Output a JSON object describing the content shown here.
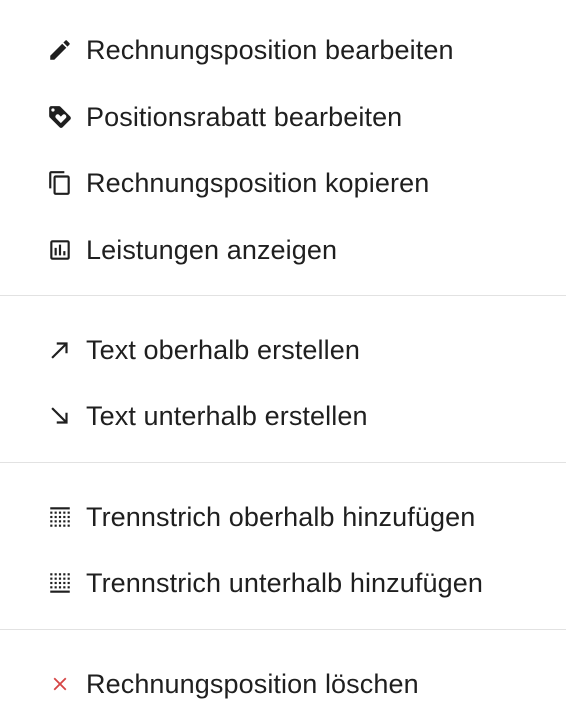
{
  "menu": {
    "items": [
      {
        "label": "Rechnungsposition bearbeiten",
        "icon": "pencil-icon"
      },
      {
        "label": "Positionsrabatt bearbeiten",
        "icon": "tag-icon"
      },
      {
        "label": "Rechnungsposition kopieren",
        "icon": "copy-icon"
      },
      {
        "label": "Leistungen anzeigen",
        "icon": "bar-chart-icon"
      },
      {
        "label": "Text oberhalb erstellen",
        "icon": "arrow-up-right-icon"
      },
      {
        "label": "Text unterhalb erstellen",
        "icon": "arrow-down-right-icon"
      },
      {
        "label": "Trennstrich oberhalb hinzufügen",
        "icon": "border-top-icon"
      },
      {
        "label": "Trennstrich unterhalb hinzufügen",
        "icon": "border-bottom-icon"
      },
      {
        "label": "Rechnungsposition löschen",
        "icon": "close-icon"
      }
    ]
  },
  "colors": {
    "text": "#1f1f1f",
    "icon": "#1f1f1f",
    "danger": "#d64545",
    "divider": "#e2e2e2"
  }
}
